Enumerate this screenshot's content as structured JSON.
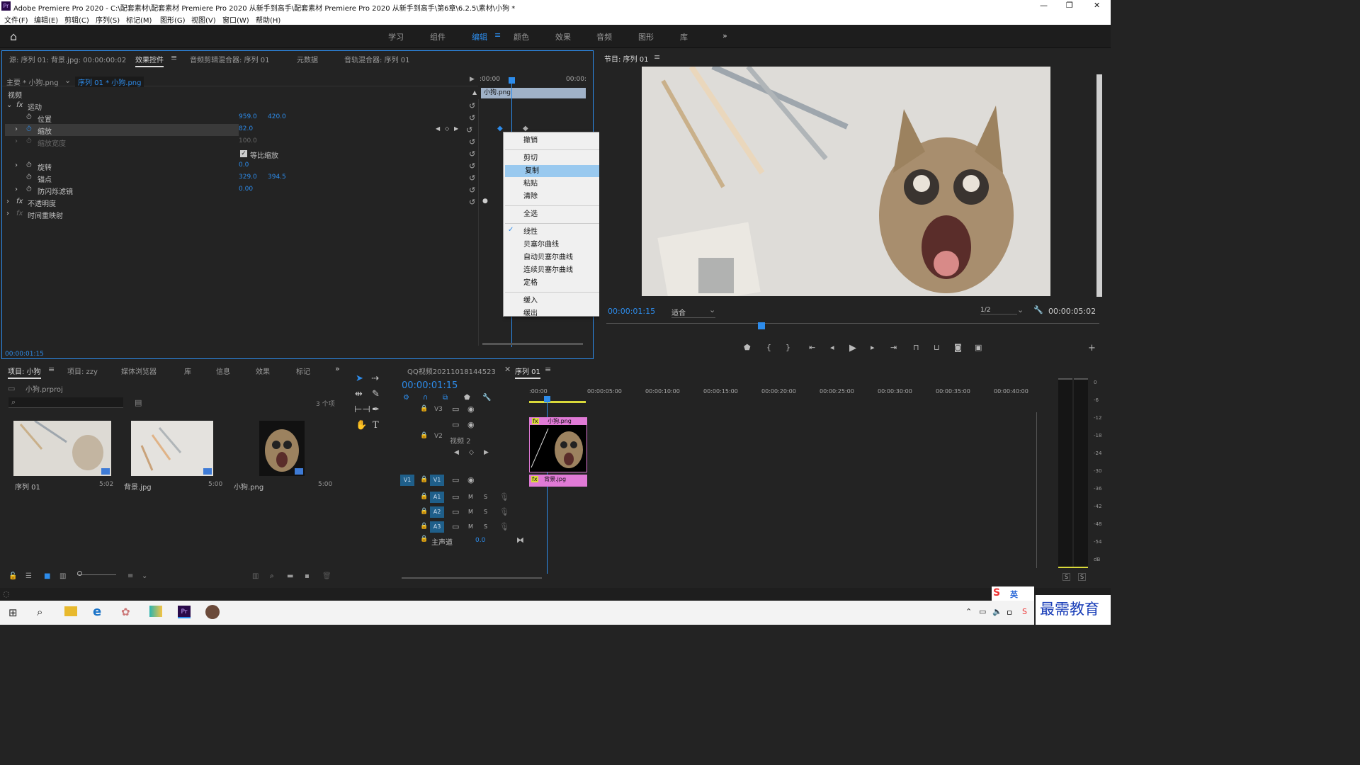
{
  "window": {
    "title": "Adobe Premiere Pro 2020 - C:\\配套素材\\配套素材 Premiere Pro 2020 从新手到高手\\配套素材 Premiere Pro 2020 从新手到高手\\第6章\\6.2.5\\素材\\小狗 *",
    "app_icon": "Pr",
    "min": "—",
    "max": "❐",
    "close": "✕"
  },
  "menu": [
    "文件(F)",
    "编辑(E)",
    "剪辑(C)",
    "序列(S)",
    "标记(M)",
    "图形(G)",
    "视图(V)",
    "窗口(W)",
    "帮助(H)"
  ],
  "workspaces": {
    "items": [
      "学习",
      "组件",
      "编辑",
      "颜色",
      "效果",
      "音频",
      "图形",
      "库"
    ],
    "active": "编辑",
    "more": "»"
  },
  "effect_panel": {
    "tabs": [
      "源: 序列 01: 背景.jpg: 00:00:00:02",
      "效果控件",
      "音频剪辑混合器: 序列 01",
      "元数据",
      "音轨混合器: 序列 01"
    ],
    "master": "主要 * 小狗.png",
    "sequence_clip": "序列 01 * 小狗.png",
    "ruler_start": ":00:00",
    "ruler_end": "00:00:",
    "clip_bar": "小狗.png",
    "section_video": "视频",
    "motion": "运动",
    "position_label": "位置",
    "position_x": "959.0",
    "position_y": "420.0",
    "scale_label": "缩放",
    "scale_val": "82.0",
    "scale_width_label": "缩放宽度",
    "scale_width_val": "100.0",
    "uniform_label": "等比缩放",
    "rotation_label": "旋转",
    "rotation_val": "0.0",
    "anchor_label": "锚点",
    "anchor_x": "329.0",
    "anchor_y": "394.5",
    "flicker_label": "防闪烁滤镜",
    "flicker_val": "0.00",
    "opacity_label": "不透明度",
    "timeremap_label": "时间重映射",
    "timecode": "00:00:01:15"
  },
  "context_menu": {
    "items": [
      {
        "label": "撤销"
      },
      {
        "sep": true
      },
      {
        "label": "剪切"
      },
      {
        "label": "复制",
        "highlight": true
      },
      {
        "label": "粘贴"
      },
      {
        "label": "清除"
      },
      {
        "sep": true
      },
      {
        "label": "全选"
      },
      {
        "sep": true
      },
      {
        "label": "线性",
        "checked": true
      },
      {
        "label": "贝塞尔曲线"
      },
      {
        "label": "自动贝塞尔曲线"
      },
      {
        "label": "连续贝塞尔曲线"
      },
      {
        "label": "定格"
      },
      {
        "sep": true
      },
      {
        "label": "缓入"
      },
      {
        "label": "缓出"
      }
    ]
  },
  "program": {
    "title": "节目: 序列 01",
    "timecode": "00:00:01:15",
    "fit": "适合",
    "quality": "1/2",
    "duration": "00:00:05:02"
  },
  "project": {
    "tabs": [
      "项目: 小狗",
      "项目: zzy",
      "媒体浏览器",
      "库",
      "信息",
      "效果",
      "标记"
    ],
    "file": "小狗.prproj",
    "count": "3 个项",
    "items": [
      {
        "name": "序列 01",
        "dur": "5:02"
      },
      {
        "name": "背景.jpg",
        "dur": "5:00"
      },
      {
        "name": "小狗.png",
        "dur": "5:00"
      }
    ]
  },
  "timeline": {
    "tabs": [
      "QQ视频20211018144523",
      "序列 01"
    ],
    "timecode": "00:00:01:15",
    "ruler": [
      ":00:00",
      "00:00:05:00",
      "00:00:10:00",
      "00:00:15:00",
      "00:00:20:00",
      "00:00:25:00",
      "00:00:30:00",
      "00:00:35:00",
      "00:00:40:00"
    ],
    "tracks": {
      "v3": "V3",
      "v2": "V2",
      "v2name": "视频 2",
      "v1": "V1",
      "a1": "A1",
      "a2": "A2",
      "a3": "A3",
      "master": "主声道",
      "master_val": "0.0",
      "m": "M",
      "s": "S"
    },
    "clip_v2": "小狗.png",
    "clip_v1": "背景.jpg",
    "fx": "fx"
  },
  "meter": {
    "labels": [
      "0",
      "-6",
      "-12",
      "-18",
      "-24",
      "-30",
      "-36",
      "-42",
      "-48",
      "-54",
      "dB"
    ],
    "s": "S"
  },
  "ime": {
    "lang": "英"
  },
  "watermark": "最需教育",
  "colors": {
    "accent": "#2d8ceb",
    "clip_pink": "#e07ad6",
    "menu_hl": "#99c9ef"
  }
}
